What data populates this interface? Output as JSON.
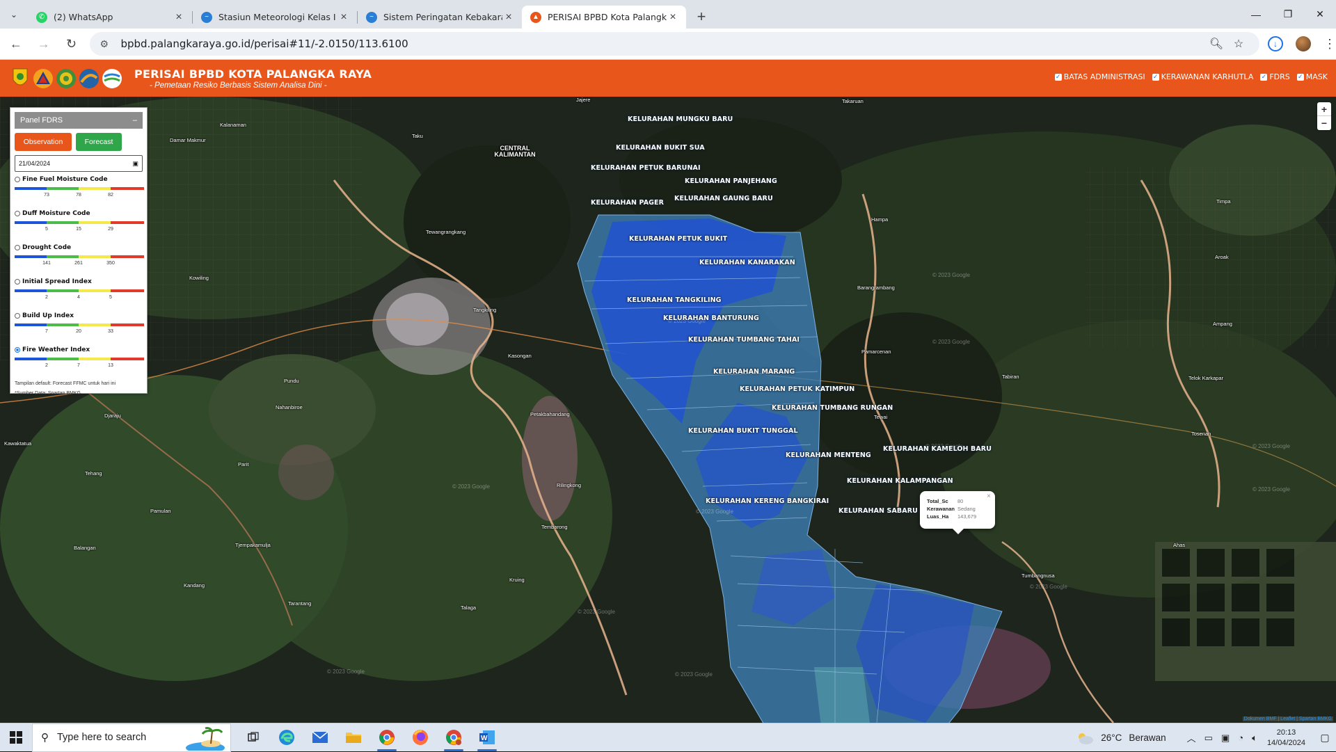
{
  "browser": {
    "tabs": [
      {
        "title": "(2) WhatsApp",
        "icon": "whatsapp-icon",
        "color": "#25d366",
        "active": false
      },
      {
        "title": "Stasiun Meteorologi Kelas I Tjilik",
        "icon": "bmkg-icon",
        "color": "#2a7fd4",
        "active": false
      },
      {
        "title": "Sistem Peringatan Kebakaran Huta",
        "icon": "bmkg-icon",
        "color": "#2a7fd4",
        "active": false
      },
      {
        "title": "PERISAI BPBD Kota Palangka Raya",
        "icon": "bpbd-icon",
        "color": "#e9561c",
        "active": true
      }
    ],
    "url": "bpbd.palangkaraya.go.id/perisai#11/-2.0150/113.6100"
  },
  "header": {
    "title": "PERISAI BPBD KOTA PALANGKA RAYA",
    "subtitle": "- Pemetaan Resiko Berbasis Sistem Analisa Dini -",
    "logos": [
      {
        "name": "kota-palangka-raya-logo",
        "caption": "Kota Palangka Raya",
        "color": "#e8c21a"
      },
      {
        "name": "bpbd-logo",
        "caption": "BPBD Kota Palangka Raya",
        "color": "#d32b1f"
      },
      {
        "name": "kabupaten-logo",
        "caption": "Dinas Kota Palangka Raya",
        "color": "#3f8f3a"
      },
      {
        "name": "dinas-logo",
        "caption": "Dinas PUPR Kota Palangka Raya",
        "color": "#2363a8"
      },
      {
        "name": "bmkg-logo",
        "caption": "BMKG",
        "color": "#ffffff"
      }
    ],
    "layers": [
      "BATAS ADMINISTRASI",
      "KERAWANAN KARHUTLA",
      "FDRS",
      "MASK"
    ]
  },
  "panel": {
    "title": "Panel FDRS",
    "collapse": "–",
    "tab_observation": "Observation",
    "tab_forecast": "Forecast",
    "date": "21/04/2024",
    "indices": [
      {
        "label": "Fine Fuel Moisture Code",
        "ticks": [
          "73",
          "78",
          "82"
        ],
        "selected": false
      },
      {
        "label": "Duff Moisture Code",
        "ticks": [
          "5",
          "15",
          "29"
        ],
        "selected": false
      },
      {
        "label": "Drought Code",
        "ticks": [
          "141",
          "261",
          "350"
        ],
        "selected": false
      },
      {
        "label": "Initial Spread Index",
        "ticks": [
          "2",
          "4",
          "5"
        ],
        "selected": false
      },
      {
        "label": "Build Up Index",
        "ticks": [
          "7",
          "20",
          "33"
        ],
        "selected": false
      },
      {
        "label": "Fire Weather Index",
        "ticks": [
          "2",
          "7",
          "13"
        ],
        "selected": true
      }
    ],
    "scale_colors": [
      "#1e55d8",
      "#4cbb47",
      "#f4e84a",
      "#e03b2a"
    ],
    "note1": "Tampilan default: Forecast FFMC untuk hari ini",
    "note2": "*Sumber Data: Spartan BMKG"
  },
  "map": {
    "kelurahan": [
      "KELURAHAN MUNGKU BARU",
      "KELURAHAN BUKIT SUA",
      "KELURAHAN PETUK BARUNAI",
      "KELURAHAN PANJEHANG",
      "KELURAHAN PAGER",
      "KELURAHAN GAUNG BARU",
      "KELURAHAN PETUK BUKIT",
      "KELURAHAN KANARAKAN",
      "KELURAHAN TANGKILING",
      "KELURAHAN BANTURUNG",
      "KELURAHAN TUMBANG TAHAI",
      "KELURAHAN MARANG",
      "KELURAHAN PETUK KATIMPUN",
      "KELURAHAN TUMBANG RUNGAN",
      "KELURAHAN BUKIT TUNGGAL",
      "KELURAHAN KAMELOH BARU",
      "KELURAHAN MENTENG",
      "KELURAHAN KALAMPANGAN",
      "KELURAHAN KERENG BANGKIRAI",
      "KELURAHAN SABARU"
    ],
    "places": [
      "Jajere",
      "Takaruan",
      "Kalanaman",
      "Damar Makmur",
      "Taku",
      "Tewangrangkang",
      "Hampa",
      "Timpa",
      "Aroak",
      "Kowiling",
      "Tangkiling",
      "Barangrambang",
      "Ampang",
      "Pamarcenan",
      "Pundu",
      "Kasongan",
      "Tabiran",
      "Telok Karkapar",
      "Nahanbiroe",
      "Petakbahandang",
      "Tewai",
      "Tosenan",
      "Kawaktatua",
      "Djaraju",
      "Parit",
      "Tehang",
      "Rilingkong",
      "Pamulan",
      "Tembarong",
      "Ahas",
      "Balangan",
      "Tjempakamulja",
      "Kandang",
      "Kruing",
      "Tumbangnusa",
      "Tarantang",
      "Talaga"
    ],
    "central_kalimantan": "CENTRAL KALIMANTAN",
    "watermark": "© 2023 Google",
    "attribution": "Dokumen BMF | Leaflet | Spartan BMKG",
    "zoom_in": "+",
    "zoom_out": "−",
    "popup": {
      "rows": [
        {
          "k": "Total_Sc",
          "v": "80"
        },
        {
          "k": "Kerawanan",
          "v": "Sedang"
        },
        {
          "k": "Luas_Ha",
          "v": "143,679"
        }
      ],
      "close": "×"
    },
    "fill_colors": {
      "high_risk": "#1f4fd9",
      "medium": "#3d7fb6",
      "river": "#e7b48d"
    }
  },
  "taskbar": {
    "search_placeholder": "Type here to search",
    "weather_temp": "26°C",
    "weather_text": "Berawan",
    "time": "20:13",
    "date": "14/04/2024"
  }
}
